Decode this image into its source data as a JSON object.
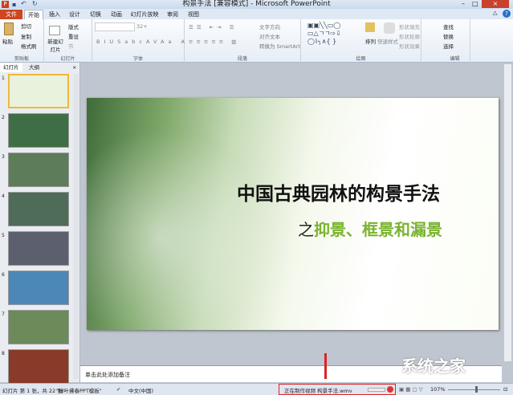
{
  "window": {
    "title": "构景手法 [兼容模式] - Microsoft PowerPoint"
  },
  "tabs": [
    "文件",
    "开始",
    "插入",
    "设计",
    "切换",
    "动画",
    "幻灯片放映",
    "审阅",
    "视图"
  ],
  "ribbon": {
    "clipboard": {
      "label": "剪贴板",
      "paste": "粘贴",
      "cut": "剪切",
      "copy": "复制",
      "format": "格式刷"
    },
    "slides": {
      "label": "幻灯片",
      "new": "新建幻灯片",
      "layout": "版式",
      "reset": "重设",
      "section": "节"
    },
    "font": {
      "label": "字体",
      "size": "32+"
    },
    "paragraph": {
      "label": "段落",
      "dir": "文字方向",
      "align": "对齐文本",
      "smartart": "转换为 SmartArt"
    },
    "drawing": {
      "label": "绘图",
      "arrange": "排列",
      "quick": "快速样式",
      "fill": "形状填充",
      "outline": "形状轮廓",
      "effect": "形状效果"
    },
    "editing": {
      "label": "编辑",
      "find": "查找",
      "replace": "替换",
      "select": "选择"
    }
  },
  "pane": {
    "tabs": [
      "幻灯片",
      "大纲"
    ],
    "close": "×",
    "slides": [
      "1",
      "2",
      "3",
      "4",
      "5",
      "6",
      "7",
      "8"
    ]
  },
  "slide": {
    "title": "中国古典园林的构景手法",
    "sub_prefix": "之",
    "sub_main": "抑景、框景和漏景"
  },
  "notes": {
    "placeholder": "单击此处添加备注"
  },
  "status": {
    "slide": "幻灯片 第 1 张，共 22 张",
    "theme": "\"绿叶拂春PPT模板\"",
    "lang": "中文(中国)",
    "progress": "正在制作视频 构景手法.wmv",
    "zoom": "107%"
  },
  "watermark": "系统之家"
}
